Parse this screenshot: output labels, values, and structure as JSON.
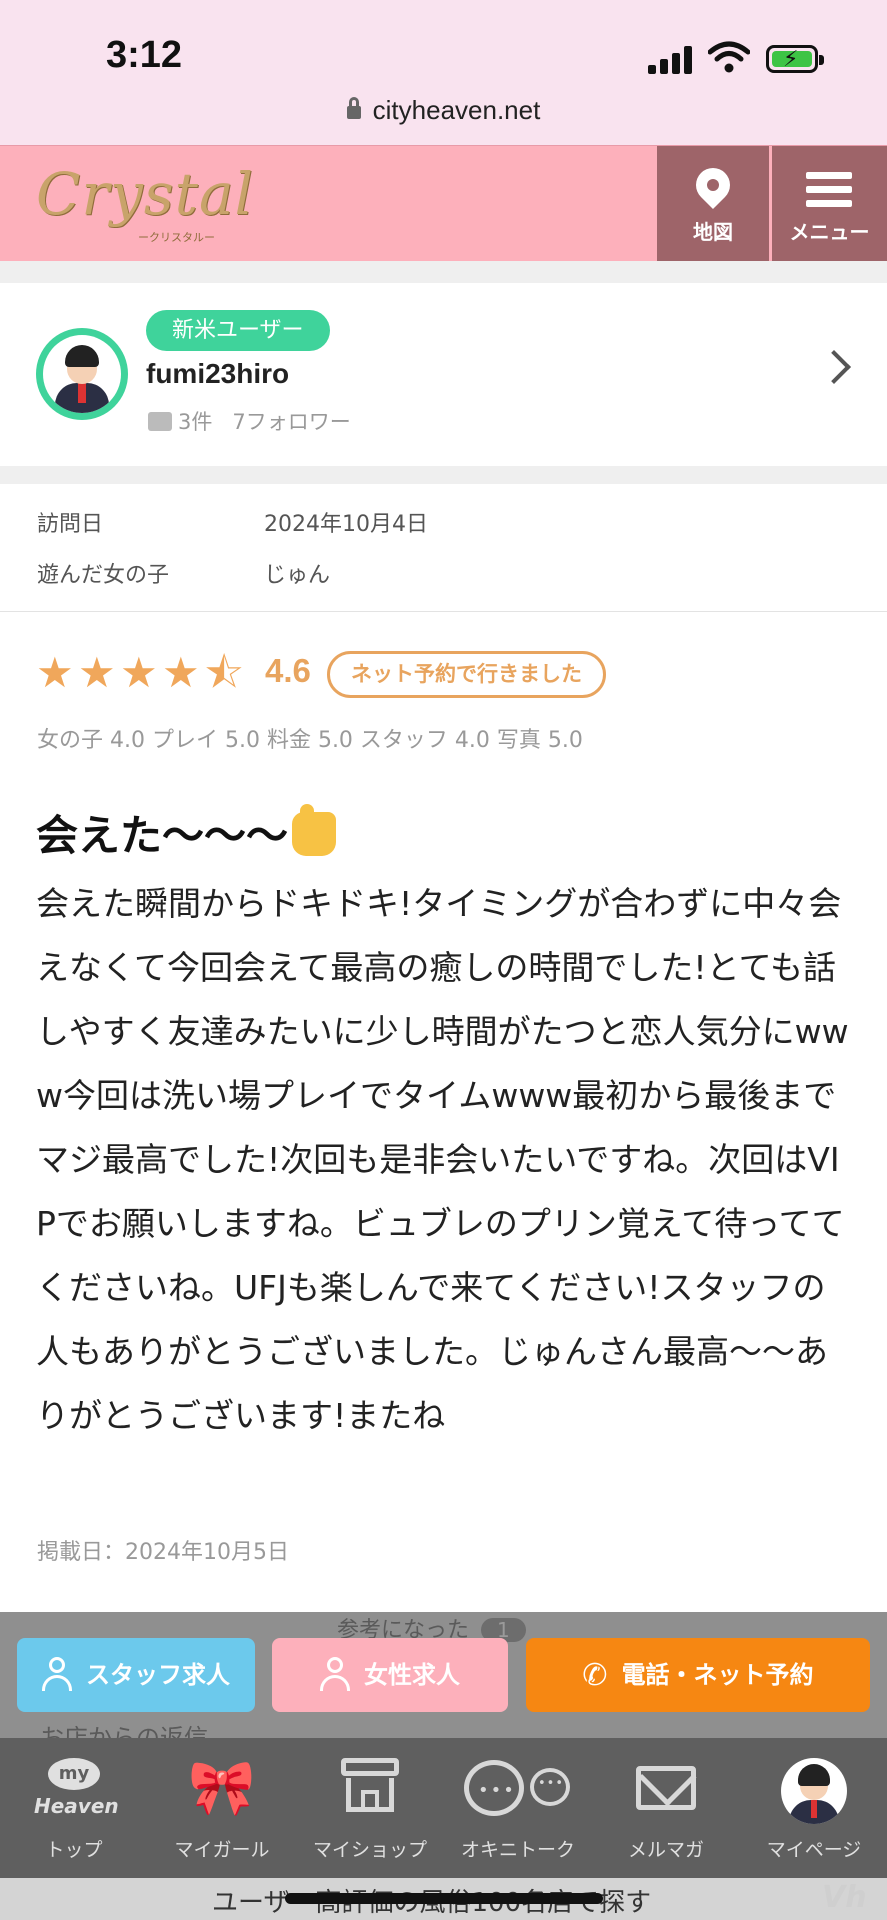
{
  "status": {
    "time": "3:12",
    "url": "cityheaven.net"
  },
  "header": {
    "logo": "Crystal",
    "logo_sub": "ークリスタルー",
    "map_label": "地図",
    "menu_label": "メニュー"
  },
  "user": {
    "badge": "新米ユーザー",
    "name": "fumi23hiro",
    "posts": "3件",
    "followers": "7フォロワー"
  },
  "visit": {
    "date_label": "訪問日",
    "date_value": "2024年10月4日",
    "girl_label": "遊んだ女の子",
    "girl_value": "じゅん"
  },
  "rating": {
    "score": "4.6",
    "stars": 4.6,
    "badge": "ネット予約で行きました",
    "breakdown": "女の子 4.0 プレイ 5.0 料金 5.0 スタッフ 4.0 写真 5.0"
  },
  "review": {
    "title": "会えた〜〜〜",
    "body": "会えた瞬間からドキドキ!タイミングが合わずに中々会えなくて今回会えて最高の癒しの時間でした!とても話しやすく友達みたいに少し時間がたつと恋人気分にwww今回は洗い場プレイでタイムwww最初から最後までマジ最高でした!次回も是非会いたいですね。次回はVIPでお願いしますね。ビュブレのプリン覚えて待っててくださいね。UFJも楽しんで来てください!スタッフの人もありがとうございました。じゅんさん最高〜〜ありがとうございます!またね",
    "posted": "掲載日：2024年10月5日"
  },
  "helpful": {
    "label": "参考になった",
    "count": "1"
  },
  "cta": {
    "staff": "スタッフ求人",
    "female": "女性求人",
    "phone": "電話・ネット予約"
  },
  "shop_reply": "お店からの返信",
  "tabs": {
    "top": "トップ",
    "mygirl": "マイガール",
    "myshop": "マイショップ",
    "talk": "オキニトーク",
    "mailmag": "メルマガ",
    "mypage": "マイページ"
  },
  "tab_logo": {
    "my": "my",
    "heaven": "Heaven"
  },
  "bottom_strip": "ユーザー高評価の風俗100名店で探す",
  "colors": {
    "header_bg": "#fdb0bb",
    "accent_green": "#3fd39b",
    "star": "#f0a75b",
    "cta_blue": "#6cc9ec",
    "cta_pink": "#fdb0bb",
    "cta_orange": "#f68712"
  }
}
